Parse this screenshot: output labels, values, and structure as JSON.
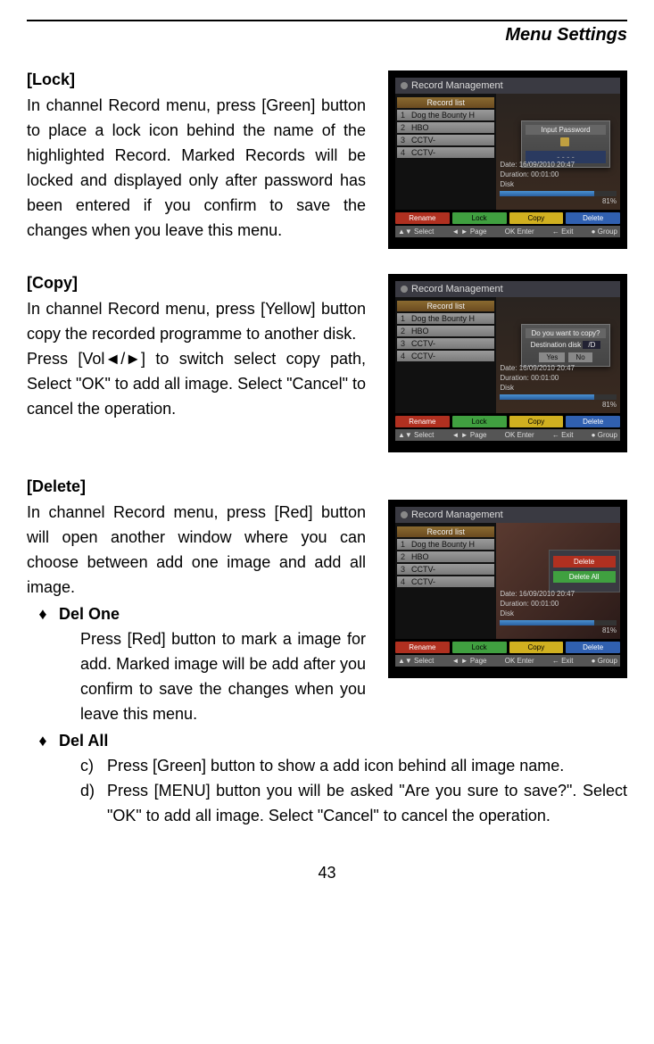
{
  "header": {
    "title": "Menu Settings"
  },
  "page_number": "43",
  "sections": {
    "lock": {
      "heading": "[Lock]",
      "body": "In channel Record menu, press [Green] button to place a lock icon behind the name of the highlighted Record. Marked Records will be locked and displayed only after password has been entered if you confirm to save the changes when you leave this menu."
    },
    "copy": {
      "heading": "[Copy]",
      "body1": "In channel Record menu, press [Yellow] button copy the recorded programme to another disk.",
      "body2": "Press [Vol◄/►] to switch select copy path, Select \"OK\" to add all image. Select \"Cancel\" to cancel the operation."
    },
    "delete": {
      "heading": "[Delete]",
      "intro": "In channel Record menu, press [Red] button will open another window where you can choose between add one image and add all image.",
      "del_one_label": "Del One",
      "del_one_body": "Press [Red] button to mark a image for add. Marked image will be add after you confirm to save the changes when you leave this menu.",
      "del_all_label": "Del All",
      "step_c_label": "c)",
      "step_c": "Press [Green] button to show a add icon behind all image name.",
      "step_d_label": "d)",
      "step_d": "Press [MENU] button you will be asked \"Are you sure to save?\". Select \"OK\" to add all image. Select \"Cancel\" to cancel the operation."
    }
  },
  "figure": {
    "title": "Record Management",
    "list_header": "Record list",
    "rows": [
      {
        "n": "1",
        "name": "Dog the Bounty H"
      },
      {
        "n": "2",
        "name": "HBO"
      },
      {
        "n": "3",
        "name": "CCTV-"
      },
      {
        "n": "4",
        "name": "CCTV-"
      }
    ],
    "info_date": "Date: 16/09/2010 20:47",
    "info_duration": "Duration: 00:01:00",
    "info_disk": "Disk",
    "info_pct": "81%",
    "buttons": {
      "rename": "Rename",
      "lock": "Lock",
      "copy": "Copy",
      "delete": "Delete"
    },
    "footer": {
      "select": "▲▼ Select",
      "page": "◄ ► Page",
      "enter": "OK Enter",
      "exit": "← Exit",
      "group": "● Group"
    },
    "dlg_lock": {
      "title": "Input Password",
      "dots": "- - - -"
    },
    "dlg_copy": {
      "q": "Do you want to copy?",
      "dest": "Destination disk",
      "path": "/D",
      "yes": "Yes",
      "no": "No"
    },
    "dlg_del": {
      "del": "Delete",
      "delall": "Delete All"
    }
  }
}
